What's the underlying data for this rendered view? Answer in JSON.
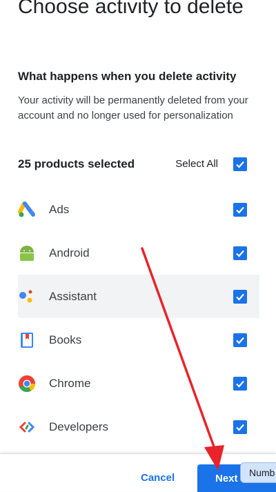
{
  "page": {
    "title": "Choose activity to delete",
    "subheading": "What happens when you delete activity",
    "description": "Your activity will be permanently deleted from your account and no longer used for personalization"
  },
  "summary": {
    "count_text": "25 products selected",
    "select_all_label": "Select All"
  },
  "products": [
    {
      "label": "Ads",
      "icon": "google-ads-icon",
      "checked": true
    },
    {
      "label": "Android",
      "icon": "android-icon",
      "checked": true
    },
    {
      "label": "Assistant",
      "icon": "google-assistant-icon",
      "checked": true
    },
    {
      "label": "Books",
      "icon": "google-books-icon",
      "checked": true
    },
    {
      "label": "Chrome",
      "icon": "chrome-icon",
      "checked": true
    },
    {
      "label": "Developers",
      "icon": "google-developers-icon",
      "checked": true
    }
  ],
  "footer": {
    "cancel_label": "Cancel",
    "next_label": "Next",
    "tooltip_text": "Numb"
  },
  "colors": {
    "accent": "#1a73e8",
    "annotation_arrow": "#e8232a"
  }
}
